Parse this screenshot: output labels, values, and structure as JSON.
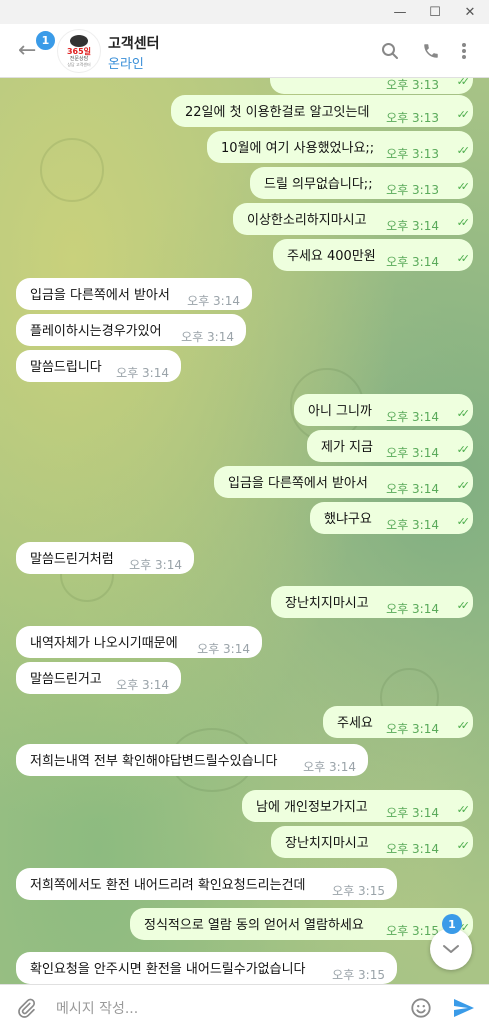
{
  "window": {
    "minimize": "—",
    "maximize": "☐",
    "close": "✕"
  },
  "header": {
    "back_icon": "←",
    "unread_badge": "1",
    "avatar": {
      "line1": "365일",
      "line2": "전문상담",
      "line3": "상담 고객센터"
    },
    "title": "고객센터",
    "status": "온라인",
    "status_color": "#3a8fd8",
    "icons": {
      "search": "⌕",
      "call": "✆",
      "more": "⋮"
    }
  },
  "messages": [
    {
      "type": "out",
      "text": "22일에 첫 이용한걸로 알고잇는데",
      "time": "오후 3:13"
    },
    {
      "type": "out",
      "text": "10월에 여기 사용했었나요;;",
      "time": "오후 3:13"
    },
    {
      "type": "out",
      "text": "드릴 의무없습니다;;",
      "time": "오후 3:13"
    },
    {
      "type": "out",
      "text": "이상한소리하지마시고",
      "time": "오후 3:14"
    },
    {
      "type": "out",
      "text": "주세요 400만원",
      "time": "오후 3:14"
    },
    {
      "type": "in",
      "text": "입금을 다른쪽에서 받아서",
      "time": "오후 3:14"
    },
    {
      "type": "in",
      "text": "플레이하시는경우가있어",
      "time": "오후 3:14"
    },
    {
      "type": "in",
      "text": "말씀드립니다",
      "time": "오후 3:14"
    },
    {
      "type": "out",
      "text": "아니 그니까",
      "time": "오후 3:14"
    },
    {
      "type": "out",
      "text": "제가 지금",
      "time": "오후 3:14"
    },
    {
      "type": "out",
      "text": "입금을 다른쪽에서 받아서",
      "time": "오후 3:14"
    },
    {
      "type": "out",
      "text": "했냐구요",
      "time": "오후 3:14"
    },
    {
      "type": "in",
      "text": "말씀드린거처럼",
      "time": "오후 3:14"
    },
    {
      "type": "out",
      "text": "장난치지마시고",
      "time": "오후 3:14"
    },
    {
      "type": "in",
      "text": "내역자체가 나오시기때문에",
      "time": "오후 3:14"
    },
    {
      "type": "in",
      "text": "말씀드린거고",
      "time": "오후 3:14"
    },
    {
      "type": "out",
      "text": "주세요",
      "time": "오후 3:14"
    },
    {
      "type": "in",
      "text": "저희는내역 전부 확인해야답변드릴수있습니다",
      "time": "오후 3:14"
    },
    {
      "type": "out",
      "text": "남에 개인정보가지고",
      "time": "오후 3:14"
    },
    {
      "type": "out",
      "text": "장난치지마시고",
      "time": "오후 3:14"
    },
    {
      "type": "in",
      "text": "저희쪽에서도 환전 내어드리려 확인요청드리는건데",
      "time": "오후 3:15"
    },
    {
      "type": "out",
      "text": "정식적으로 열람 동의 얻어서 열람하세요",
      "time": "오후 3:15"
    },
    {
      "type": "in",
      "text": "확인요청을 안주시면 환전을 내어드릴수가없습니다",
      "time": "오후 3:15"
    }
  ],
  "partial_top": {
    "time": "오후 3:13"
  },
  "scroll_down": {
    "icon": "⌄",
    "badge": "1"
  },
  "composer": {
    "placeholder": "메시지 작성...",
    "attach_icon": "📎",
    "emoji_icon": "☺"
  },
  "colors": {
    "outgoing_bubble": "#eeffde",
    "incoming_bubble": "#ffffff",
    "accent": "#3a9be8",
    "check": "#4fae4e"
  }
}
